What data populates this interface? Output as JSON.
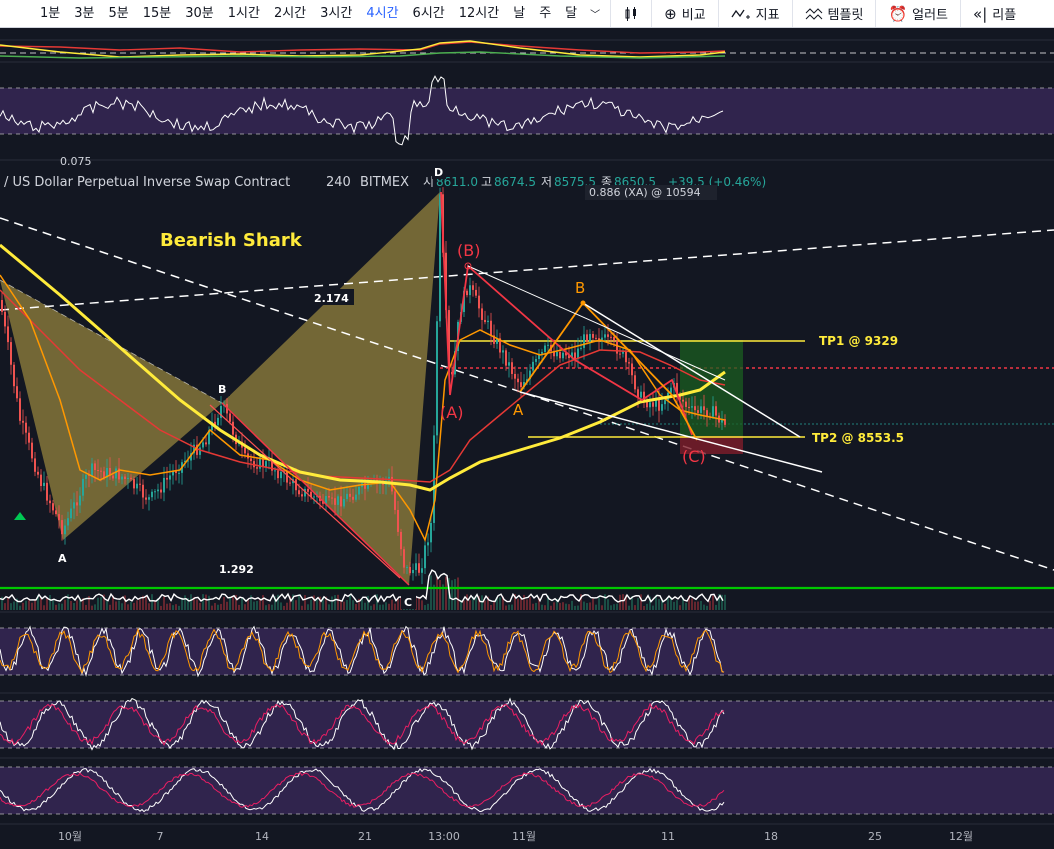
{
  "toolbar": {
    "timeframes": [
      "1분",
      "3분",
      "5분",
      "15분",
      "30분",
      "1시간",
      "2시간",
      "3시간",
      "4시간",
      "6시간",
      "12시간",
      "날",
      "주",
      "달"
    ],
    "active_timeframe": "4시간",
    "chevron": "﹀",
    "compare_label": "비교",
    "indicators_label": "지표",
    "templates_label": "템플릿",
    "alert_label": "얼러트",
    "replay_label": "리플"
  },
  "chart_header": {
    "symbol_text": "/ US Dollar Perpetual Inverse Swap Contract",
    "interval": "240",
    "exchange": "BITMEX",
    "open_label": "시",
    "open": "8611.0",
    "high_label": "고",
    "high": "8674.5",
    "low_label": "저",
    "low": "8575.5",
    "close_label": "종",
    "close": "8650.5",
    "change": "+39.5 (+0.46%)",
    "top_fragment": "0.075"
  },
  "annotations": {
    "pattern_label": "Bearish Shark",
    "ratio_2174": "2.174",
    "ratio_1292": "1.292",
    "ratio_0886": "0.886 (XA) @ 10594",
    "point_d": "D",
    "point_b": "B",
    "point_a": "A",
    "point_c": "C",
    "wave_b_paren": "(B)",
    "wave_a_paren": "(A)",
    "wave_c_paren": "(C)",
    "wave_a": "A",
    "wave_b": "B",
    "tp1": "TP1 @ 9329",
    "tp2": "TP2 @ 8553.5"
  },
  "x_axis": {
    "ticks": [
      "10월",
      "7",
      "14",
      "21",
      "13:00",
      "11월",
      "11",
      "18",
      "25",
      "12월"
    ]
  },
  "colors": {
    "background": "#131722",
    "pattern_fill": "#9c8a3f",
    "yellow": "#ffeb3b",
    "orange": "#ff9800",
    "red": "#f23645",
    "green": "#00c800",
    "purple": "#3b2a5c",
    "up_candle": "#26a69a",
    "down_candle": "#ef5350"
  }
}
